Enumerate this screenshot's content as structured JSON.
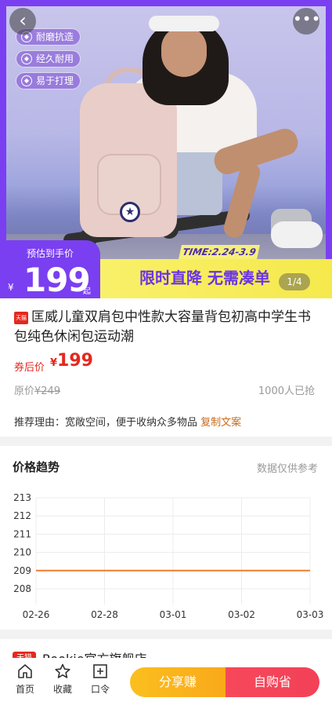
{
  "hero": {
    "badges": [
      "耐磨抗造",
      "经久耐用",
      "易于打理"
    ],
    "time_tag": "TIME:2.24-3.9",
    "price_label": "预估到手价",
    "yen": "¥",
    "price": "199",
    "qi": "起",
    "promo_text": "限时直降 无需凑单",
    "pager": "1/4"
  },
  "product": {
    "store_icon_text": "天猫",
    "title": "匡威儿童双肩包中性款大容量背包初高中学生书包纯色休闲包运动潮",
    "coupon_label": "券后价",
    "coupon_yen": "¥",
    "coupon_price": "199",
    "orig_label": "原价",
    "orig_price": "¥249",
    "sold": "1000人已抢",
    "reason_label": "推荐理由：",
    "reason_text": "宽敞空间，便于收纳众多物品",
    "copy_link": "复制文案"
  },
  "price_trend": {
    "title": "价格趋势",
    "note": "数据仅供参考"
  },
  "chart_data": {
    "type": "line",
    "x": [
      "02-26",
      "02-28",
      "03-01",
      "03-02",
      "03-03"
    ],
    "y_ticks": [
      213,
      212,
      211,
      210,
      209,
      208
    ],
    "ylim": [
      208,
      213
    ],
    "series": [
      {
        "values": [
          209,
          209,
          209,
          209,
          209
        ]
      }
    ],
    "grid": true,
    "line_color": "#f07c2e"
  },
  "shop": {
    "icon_text": "天猫",
    "name": "Rookie官方旗舰店"
  },
  "bottom_bar": {
    "home": "首页",
    "favorite": "收藏",
    "password": "口令",
    "share": "分享赚",
    "buy": "自购省"
  }
}
